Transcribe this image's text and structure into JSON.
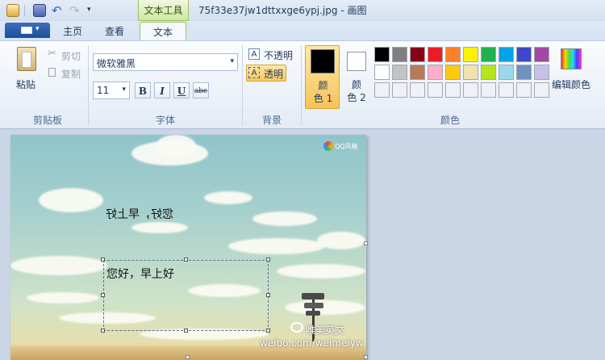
{
  "title_bar": {
    "context_tab": "文本工具",
    "window_title": "75f33e37jw1dttxxge6ypj.jpg - 画图"
  },
  "tabs": [
    {
      "label": "主页"
    },
    {
      "label": "查看"
    },
    {
      "label": "文本"
    }
  ],
  "clipboard": {
    "paste": "粘贴",
    "cut": "剪切",
    "copy": "复制",
    "group": "剪贴板"
  },
  "font": {
    "family": "微软雅黑",
    "size": "11",
    "bold": "B",
    "italic": "I",
    "underline": "U",
    "strikethrough": "abc",
    "group": "字体"
  },
  "background": {
    "opaque": "不透明",
    "transparent": "透明",
    "group": "背景"
  },
  "colors": {
    "color1_line1": "颜",
    "color1_line2": "色 1",
    "color2_line1": "颜",
    "color2_line2": "色 2",
    "edit": "编辑颜色",
    "group": "颜色",
    "color1_value": "#000000",
    "color2_value": "#ffffff",
    "palette_row1": [
      "#000000",
      "#7f7f7f",
      "#880015",
      "#ed1c24",
      "#ff7f27",
      "#fff200",
      "#22b14c",
      "#00a2e8",
      "#3f48cc",
      "#a349a4"
    ],
    "palette_row2": [
      "#ffffff",
      "#c3c3c3",
      "#b97a57",
      "#ffaec9",
      "#ffc90e",
      "#efe4b0",
      "#b5e61d",
      "#99d9ea",
      "#7092be",
      "#c8bfe7"
    ]
  },
  "canvas": {
    "mirrored_text": "您好，早上好",
    "text_box_value": "您好，早上好",
    "logo_text": "QQ风格",
    "watermark_name": "唯美英文",
    "watermark_url": "weibo.com/weimeiyw"
  }
}
